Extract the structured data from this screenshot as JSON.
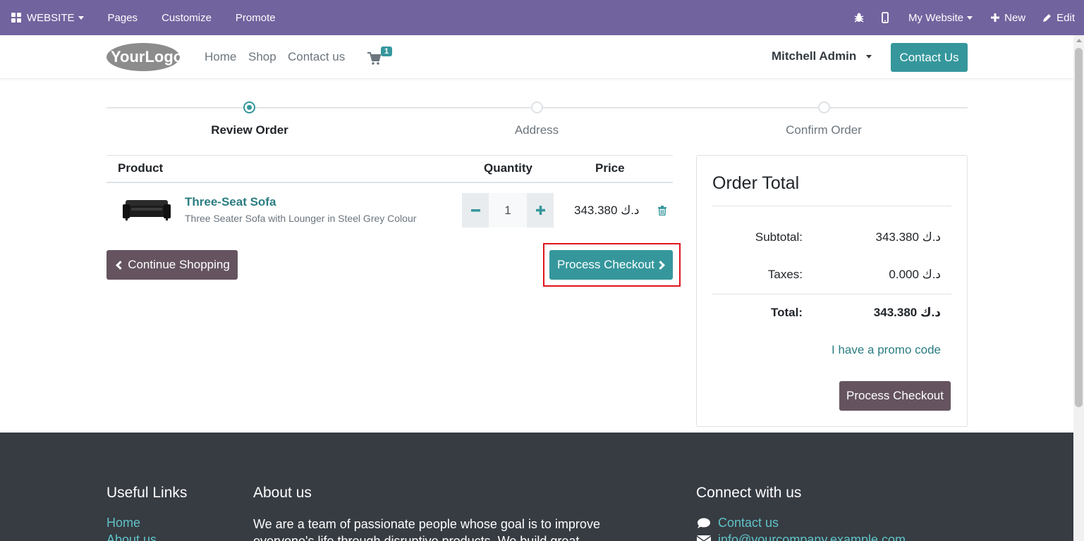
{
  "admin_bar": {
    "website_menu": "WEBSITE",
    "pages": "Pages",
    "customize": "Customize",
    "promote": "Promote",
    "my_website": "My Website",
    "new": "New",
    "edit": "Edit"
  },
  "header": {
    "logo_text": "YourLogo",
    "nav": [
      "Home",
      "Shop",
      "Contact us"
    ],
    "cart_count": "1",
    "user_name": "Mitchell Admin",
    "contact_button": "Contact Us"
  },
  "wizard": {
    "steps": [
      {
        "label": "Review Order",
        "active": true
      },
      {
        "label": "Address",
        "active": false
      },
      {
        "label": "Confirm Order",
        "active": false
      }
    ]
  },
  "cart": {
    "columns": {
      "product": "Product",
      "quantity": "Quantity",
      "price": "Price"
    },
    "lines": [
      {
        "name": "Three-Seat Sofa",
        "description": "Three Seater Sofa with Lounger in Steel Grey Colour",
        "quantity": "1",
        "price": "343.380 د.ك"
      }
    ],
    "continue_button": "Continue Shopping",
    "checkout_button": "Process Checkout"
  },
  "order_total": {
    "title": "Order Total",
    "subtotal_label": "Subtotal:",
    "subtotal_value": "343.380 د.ك",
    "taxes_label": "Taxes:",
    "taxes_value": "0.000 د.ك",
    "total_label": "Total:",
    "total_value": "343.380 د.ك",
    "promo_link": "I have a promo code",
    "checkout_button": "Process Checkout"
  },
  "footer": {
    "useful_links_title": "Useful Links",
    "useful_links": [
      "Home",
      "About us"
    ],
    "about_title": "About us",
    "about_text": "We are a team of passionate people whose goal is to improve everyone's life through disruptive products. We build great",
    "connect_title": "Connect with us",
    "connect_contact": "Contact us",
    "connect_email": "info@yourcompany.example.com"
  },
  "colors": {
    "admin_bar": "#71639e",
    "primary": "#35979c",
    "secondary": "#655460",
    "footer": "#373b42",
    "highlight": "#e0141e"
  }
}
